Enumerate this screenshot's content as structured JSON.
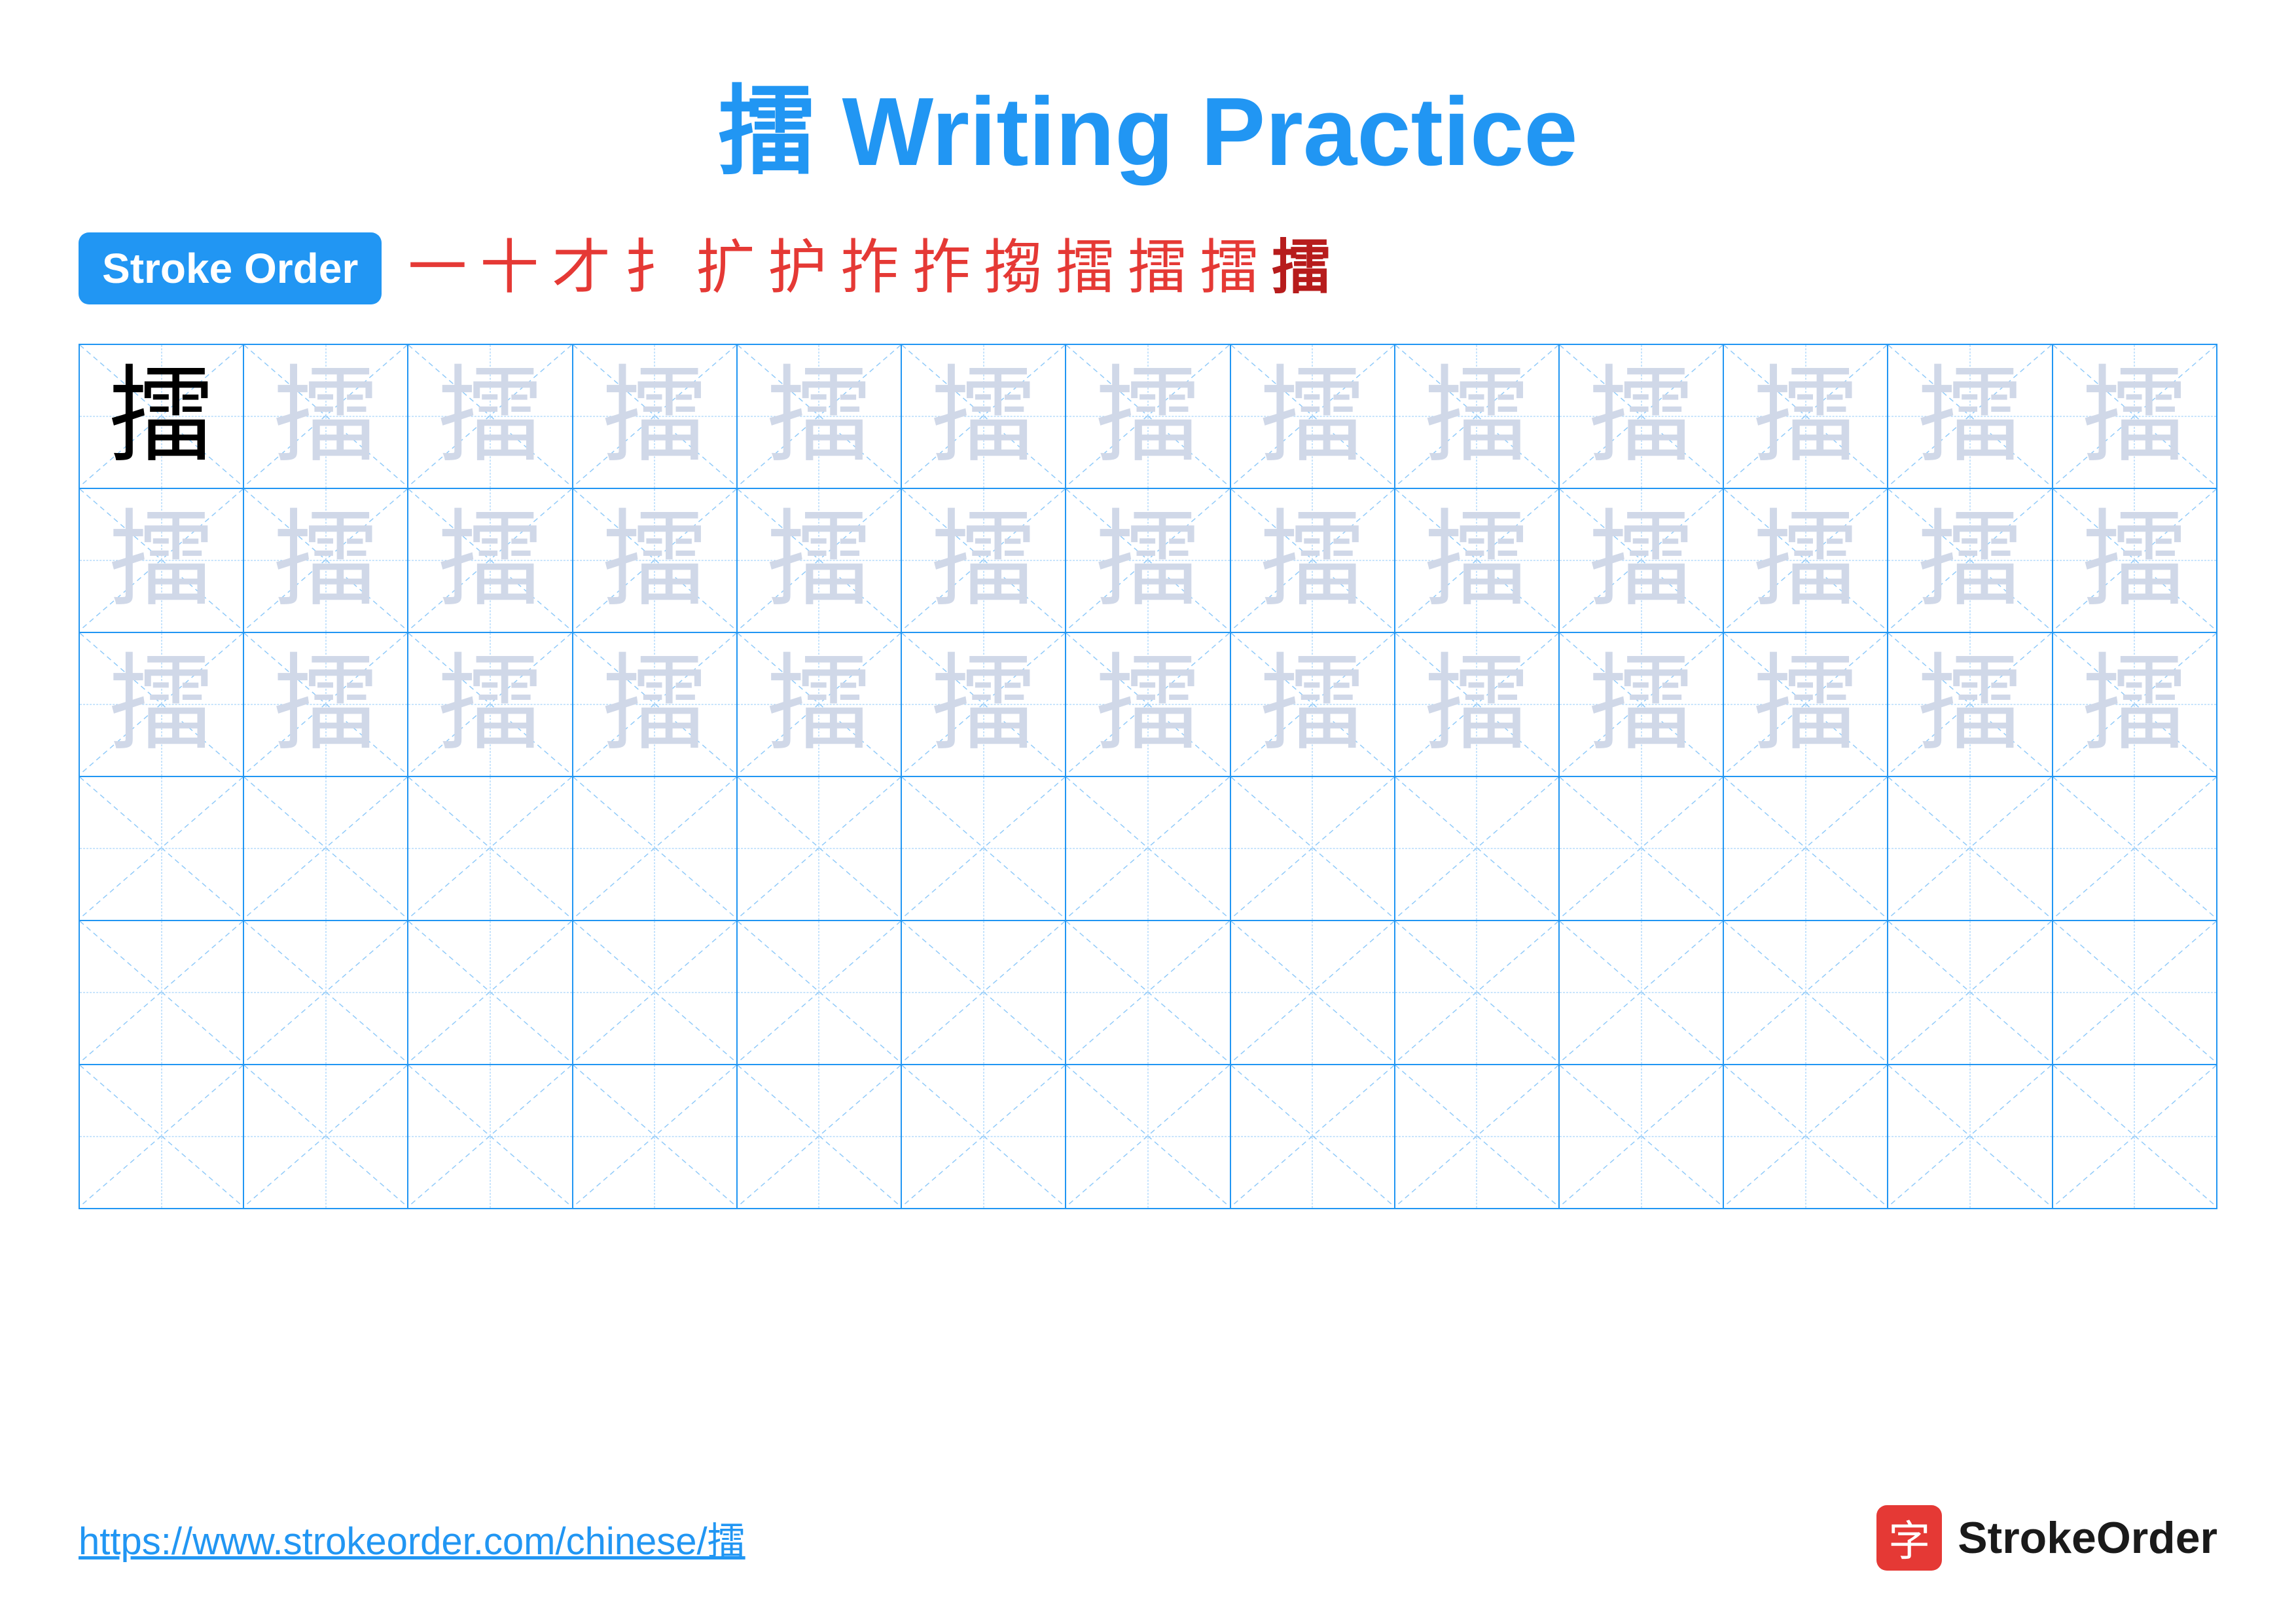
{
  "title": "擂 Writing Practice",
  "stroke_order": {
    "badge_label": "Stroke Order",
    "steps": [
      "一",
      "十",
      "才",
      "扌",
      "扩",
      "护",
      "拃",
      "拃",
      "搊",
      "擂",
      "擂",
      "擂",
      "擂"
    ]
  },
  "character": "擂",
  "grid": {
    "rows": 6,
    "cols": 13,
    "row_types": [
      "solid_then_light",
      "all_light",
      "all_light",
      "empty",
      "empty",
      "empty"
    ]
  },
  "footer": {
    "url": "https://www.strokeorder.com/chinese/擂",
    "brand": "StrokeOrder"
  }
}
